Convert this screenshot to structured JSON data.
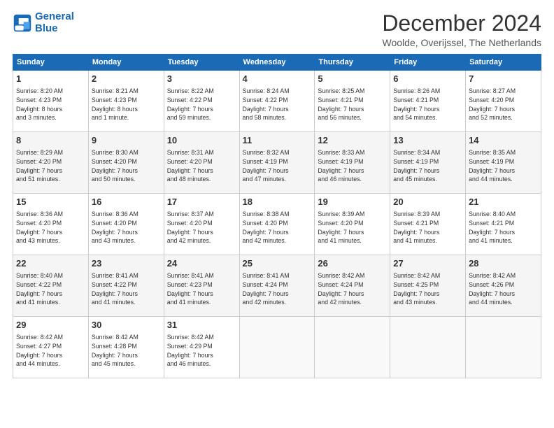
{
  "header": {
    "logo_line1": "General",
    "logo_line2": "Blue",
    "title": "December 2024",
    "subtitle": "Woolde, Overijssel, The Netherlands"
  },
  "days_of_week": [
    "Sunday",
    "Monday",
    "Tuesday",
    "Wednesday",
    "Thursday",
    "Friday",
    "Saturday"
  ],
  "weeks": [
    [
      {
        "day": "1",
        "detail": "Sunrise: 8:20 AM\nSunset: 4:23 PM\nDaylight: 8 hours\nand 3 minutes."
      },
      {
        "day": "2",
        "detail": "Sunrise: 8:21 AM\nSunset: 4:23 PM\nDaylight: 8 hours\nand 1 minute."
      },
      {
        "day": "3",
        "detail": "Sunrise: 8:22 AM\nSunset: 4:22 PM\nDaylight: 7 hours\nand 59 minutes."
      },
      {
        "day": "4",
        "detail": "Sunrise: 8:24 AM\nSunset: 4:22 PM\nDaylight: 7 hours\nand 58 minutes."
      },
      {
        "day": "5",
        "detail": "Sunrise: 8:25 AM\nSunset: 4:21 PM\nDaylight: 7 hours\nand 56 minutes."
      },
      {
        "day": "6",
        "detail": "Sunrise: 8:26 AM\nSunset: 4:21 PM\nDaylight: 7 hours\nand 54 minutes."
      },
      {
        "day": "7",
        "detail": "Sunrise: 8:27 AM\nSunset: 4:20 PM\nDaylight: 7 hours\nand 52 minutes."
      }
    ],
    [
      {
        "day": "8",
        "detail": "Sunrise: 8:29 AM\nSunset: 4:20 PM\nDaylight: 7 hours\nand 51 minutes."
      },
      {
        "day": "9",
        "detail": "Sunrise: 8:30 AM\nSunset: 4:20 PM\nDaylight: 7 hours\nand 50 minutes."
      },
      {
        "day": "10",
        "detail": "Sunrise: 8:31 AM\nSunset: 4:20 PM\nDaylight: 7 hours\nand 48 minutes."
      },
      {
        "day": "11",
        "detail": "Sunrise: 8:32 AM\nSunset: 4:19 PM\nDaylight: 7 hours\nand 47 minutes."
      },
      {
        "day": "12",
        "detail": "Sunrise: 8:33 AM\nSunset: 4:19 PM\nDaylight: 7 hours\nand 46 minutes."
      },
      {
        "day": "13",
        "detail": "Sunrise: 8:34 AM\nSunset: 4:19 PM\nDaylight: 7 hours\nand 45 minutes."
      },
      {
        "day": "14",
        "detail": "Sunrise: 8:35 AM\nSunset: 4:19 PM\nDaylight: 7 hours\nand 44 minutes."
      }
    ],
    [
      {
        "day": "15",
        "detail": "Sunrise: 8:36 AM\nSunset: 4:20 PM\nDaylight: 7 hours\nand 43 minutes."
      },
      {
        "day": "16",
        "detail": "Sunrise: 8:36 AM\nSunset: 4:20 PM\nDaylight: 7 hours\nand 43 minutes."
      },
      {
        "day": "17",
        "detail": "Sunrise: 8:37 AM\nSunset: 4:20 PM\nDaylight: 7 hours\nand 42 minutes."
      },
      {
        "day": "18",
        "detail": "Sunrise: 8:38 AM\nSunset: 4:20 PM\nDaylight: 7 hours\nand 42 minutes."
      },
      {
        "day": "19",
        "detail": "Sunrise: 8:39 AM\nSunset: 4:20 PM\nDaylight: 7 hours\nand 41 minutes."
      },
      {
        "day": "20",
        "detail": "Sunrise: 8:39 AM\nSunset: 4:21 PM\nDaylight: 7 hours\nand 41 minutes."
      },
      {
        "day": "21",
        "detail": "Sunrise: 8:40 AM\nSunset: 4:21 PM\nDaylight: 7 hours\nand 41 minutes."
      }
    ],
    [
      {
        "day": "22",
        "detail": "Sunrise: 8:40 AM\nSunset: 4:22 PM\nDaylight: 7 hours\nand 41 minutes."
      },
      {
        "day": "23",
        "detail": "Sunrise: 8:41 AM\nSunset: 4:22 PM\nDaylight: 7 hours\nand 41 minutes."
      },
      {
        "day": "24",
        "detail": "Sunrise: 8:41 AM\nSunset: 4:23 PM\nDaylight: 7 hours\nand 41 minutes."
      },
      {
        "day": "25",
        "detail": "Sunrise: 8:41 AM\nSunset: 4:24 PM\nDaylight: 7 hours\nand 42 minutes."
      },
      {
        "day": "26",
        "detail": "Sunrise: 8:42 AM\nSunset: 4:24 PM\nDaylight: 7 hours\nand 42 minutes."
      },
      {
        "day": "27",
        "detail": "Sunrise: 8:42 AM\nSunset: 4:25 PM\nDaylight: 7 hours\nand 43 minutes."
      },
      {
        "day": "28",
        "detail": "Sunrise: 8:42 AM\nSunset: 4:26 PM\nDaylight: 7 hours\nand 44 minutes."
      }
    ],
    [
      {
        "day": "29",
        "detail": "Sunrise: 8:42 AM\nSunset: 4:27 PM\nDaylight: 7 hours\nand 44 minutes."
      },
      {
        "day": "30",
        "detail": "Sunrise: 8:42 AM\nSunset: 4:28 PM\nDaylight: 7 hours\nand 45 minutes."
      },
      {
        "day": "31",
        "detail": "Sunrise: 8:42 AM\nSunset: 4:29 PM\nDaylight: 7 hours\nand 46 minutes."
      },
      {
        "day": "",
        "detail": ""
      },
      {
        "day": "",
        "detail": ""
      },
      {
        "day": "",
        "detail": ""
      },
      {
        "day": "",
        "detail": ""
      }
    ]
  ]
}
